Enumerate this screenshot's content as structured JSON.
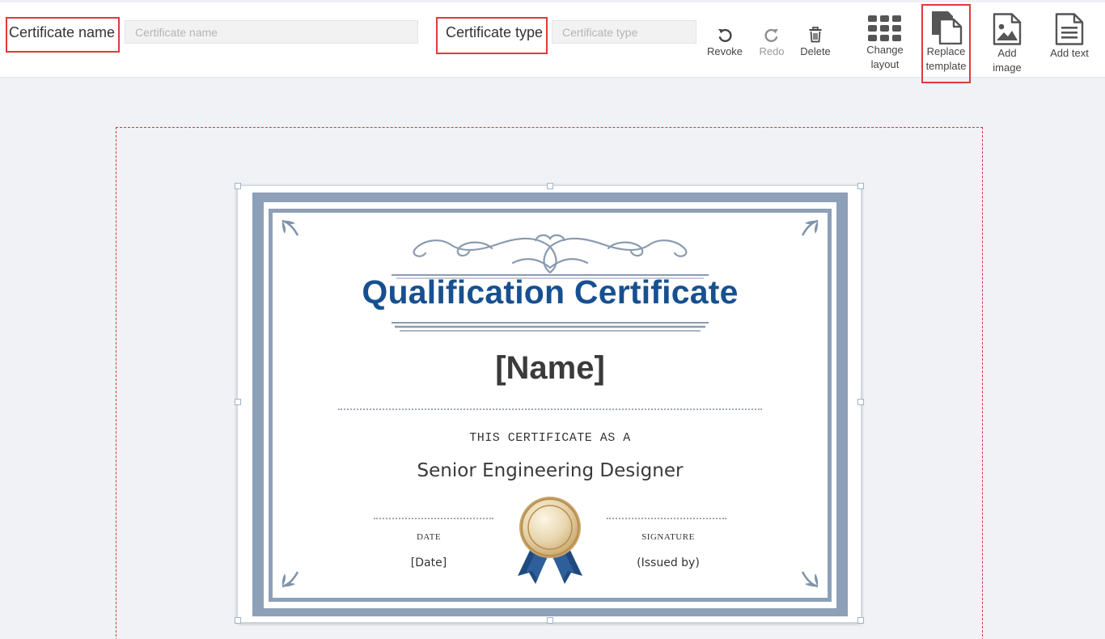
{
  "toolbar": {
    "certificate_name": {
      "label": "Certificate name",
      "placeholder": "Certificate name",
      "value": ""
    },
    "certificate_type": {
      "label": "Certificate type",
      "placeholder": "Certificate type",
      "value": ""
    },
    "actions": {
      "revoke": {
        "label": "Revoke",
        "icon": "undo-icon"
      },
      "redo": {
        "label": "Redo",
        "icon": "redo-icon"
      },
      "delete": {
        "label": "Delete",
        "icon": "trash-icon"
      }
    },
    "tools": {
      "change_layout": {
        "line1": "Change",
        "line2": "layout",
        "icon": "grid-icon"
      },
      "replace_template": {
        "line1": "Replace",
        "line2": "template",
        "icon": "copy-document-icon"
      },
      "add_image": {
        "line1": "Add",
        "line2": "image",
        "icon": "image-icon"
      },
      "add_text": {
        "label": "Add text",
        "icon": "text-document-icon"
      }
    }
  },
  "certificate": {
    "title": "Qualification Certificate",
    "name": "[Name]",
    "statement": "THIS CERTIFICATE AS A",
    "role": "Senior Engineering Designer",
    "date_caption": "DATE",
    "date_value": "[Date]",
    "signature_caption": "SIGNATURE",
    "signature_value": "(Issued by)"
  },
  "colors": {
    "highlight": "#e03a3a",
    "frame": "#8da0b7",
    "title": "#17508f",
    "ribbon": "#1f4a80",
    "medal_gold": "#c9a66b"
  }
}
